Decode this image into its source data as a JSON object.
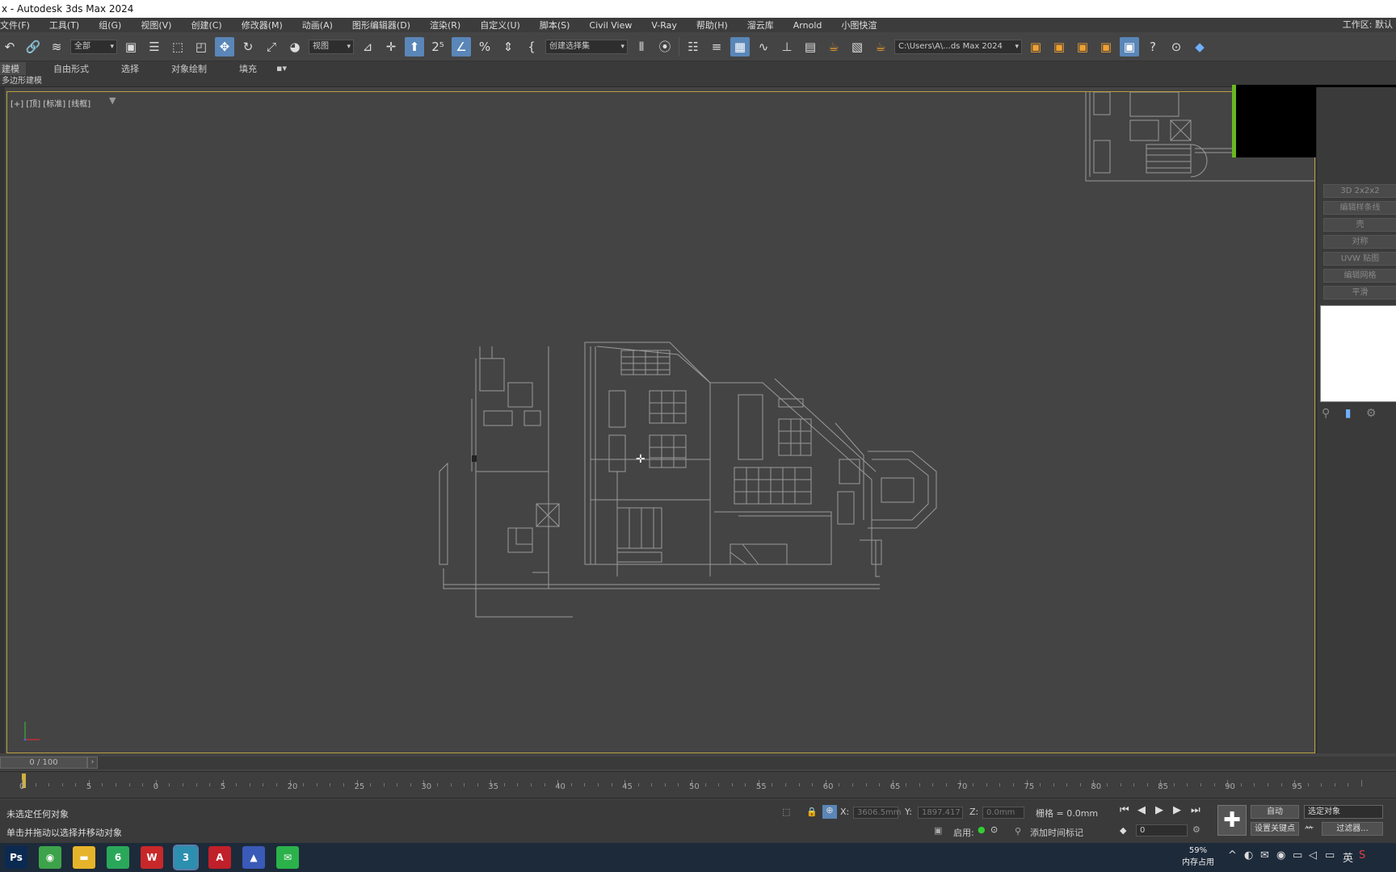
{
  "window": {
    "title": "x - Autodesk 3ds Max 2024"
  },
  "menu": {
    "items": [
      "文件(F)",
      "工具(T)",
      "组(G)",
      "视图(V)",
      "创建(C)",
      "修改器(M)",
      "动画(A)",
      "图形编辑器(D)",
      "渲染(R)",
      "自定义(U)",
      "脚本(S)",
      "Civil View",
      "V-Ray",
      "帮助(H)",
      "溜云库",
      "Arnold",
      "小图快渲"
    ],
    "workspace": "工作区: 默认"
  },
  "toolbar": {
    "selection_filter": "全部",
    "coord_system": "视图",
    "named_selection": "创建选择集",
    "project_path": "C:\\Users\\A\\...ds Max 2024"
  },
  "ribbon": {
    "tabs": [
      "建模",
      "自由形式",
      "选择",
      "对象绘制",
      "填充"
    ],
    "sub_label": "多边形建模"
  },
  "viewport": {
    "label": "[+] [顶] [标准] [线框]"
  },
  "command_panel": {
    "buttons": [
      "3D 2x2x2",
      "编辑样条线",
      "壳",
      "对称",
      "UVW 贴图",
      "编辑网格",
      "平滑"
    ]
  },
  "timeline": {
    "frame_indicator": "0 / 100",
    "labels": [
      "0",
      "5",
      "0",
      "5",
      "20",
      "25",
      "30",
      "35",
      "40",
      "45",
      "50",
      "55",
      "60",
      "65",
      "70",
      "75",
      "80",
      "85",
      "90",
      "95"
    ]
  },
  "status": {
    "line1": "未选定任何对象",
    "line2": "单击并拖动以选择并移动对象",
    "x_label": "X:",
    "x_value": "3606.5mm",
    "y_label": "Y:",
    "y_value": "1897.417",
    "z_label": "Z:",
    "z_value": "0.0mm",
    "grid": "栅格 = 0.0mm",
    "enabled": "启用:",
    "add_time_tag": "添加时间标记",
    "auto_key": "自动",
    "set_key": "设置关键点",
    "key_filter": "选定对象",
    "key_filters_btn": "过滤器...",
    "frame_field": "0"
  },
  "taskbar": {
    "apps": [
      {
        "name": "photoshop",
        "label": "Ps",
        "color": "#0b2a52"
      },
      {
        "name": "browser",
        "label": "◉",
        "color": "#3da34a"
      },
      {
        "name": "file-explorer",
        "label": "▬",
        "color": "#e6b42a"
      },
      {
        "name": "app-green",
        "label": "6",
        "color": "#2aa85a"
      },
      {
        "name": "wps",
        "label": "W",
        "color": "#c8282a"
      },
      {
        "name": "3dsmax",
        "label": "3",
        "color": "#2d8fb0"
      },
      {
        "name": "autocad",
        "label": "A",
        "color": "#c0202a"
      },
      {
        "name": "app-mountain",
        "label": "▲",
        "color": "#3a5ab8"
      },
      {
        "name": "wechat",
        "label": "✉",
        "color": "#2bb24a"
      }
    ],
    "memory_percent": "59%",
    "memory_label": "内存占用",
    "ime": "英"
  }
}
